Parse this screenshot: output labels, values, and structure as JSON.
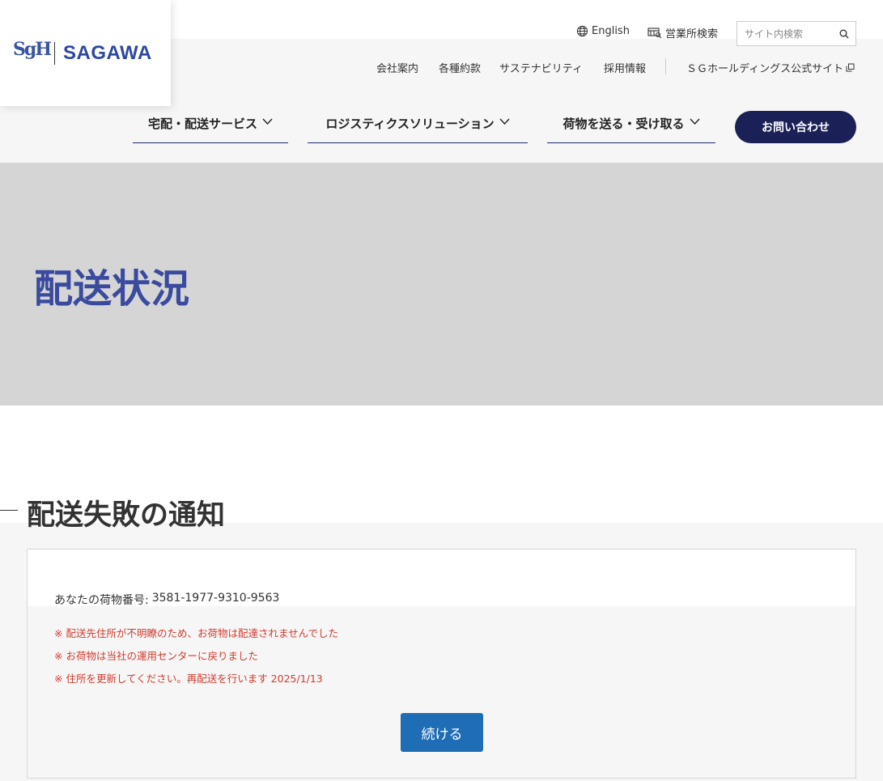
{
  "header": {
    "logo": {
      "mark": "SgH",
      "name": "SAGAWA"
    },
    "topbar": {
      "language_label": "English",
      "office_search_label": "営業所検索",
      "search_placeholder": "サイト内検索"
    },
    "subnav": {
      "items": [
        "会社案内",
        "各種約款",
        "サステナビリティ",
        "採用情報"
      ],
      "external_label": "ＳＧホールディングス公式サイト"
    },
    "mainnav": {
      "items": [
        {
          "label": "宅配・配送サービス"
        },
        {
          "label": "ロジスティクスソリューション"
        },
        {
          "label": "荷物を送る・受け取る"
        }
      ],
      "contact_label": "お問い合わせ"
    }
  },
  "hero": {
    "title": "配送状況"
  },
  "section": {
    "title": "配送失敗の通知",
    "tracking_label": "あなたの荷物番号:",
    "tracking_number": "3581-1977-9310-9563",
    "notices": [
      "※ 配送先住所が不明瞭のため、お荷物は配達されませんでした",
      "※ お荷物は当社の運用センターに戻りました",
      "※ 住所を更新してください。再配送を行います 2025/1/13"
    ],
    "continue_label": "続ける"
  },
  "colors": {
    "brand_navy": "#1b2157",
    "brand_blue": "#3a4a9e",
    "button_blue": "#1e6db5",
    "notice_red": "#d23b2f",
    "hero_gray": "#d5d5d5"
  },
  "icons": [
    "globe-icon",
    "office-icon",
    "search-icon",
    "chevron-down-icon",
    "external-link-icon"
  ]
}
